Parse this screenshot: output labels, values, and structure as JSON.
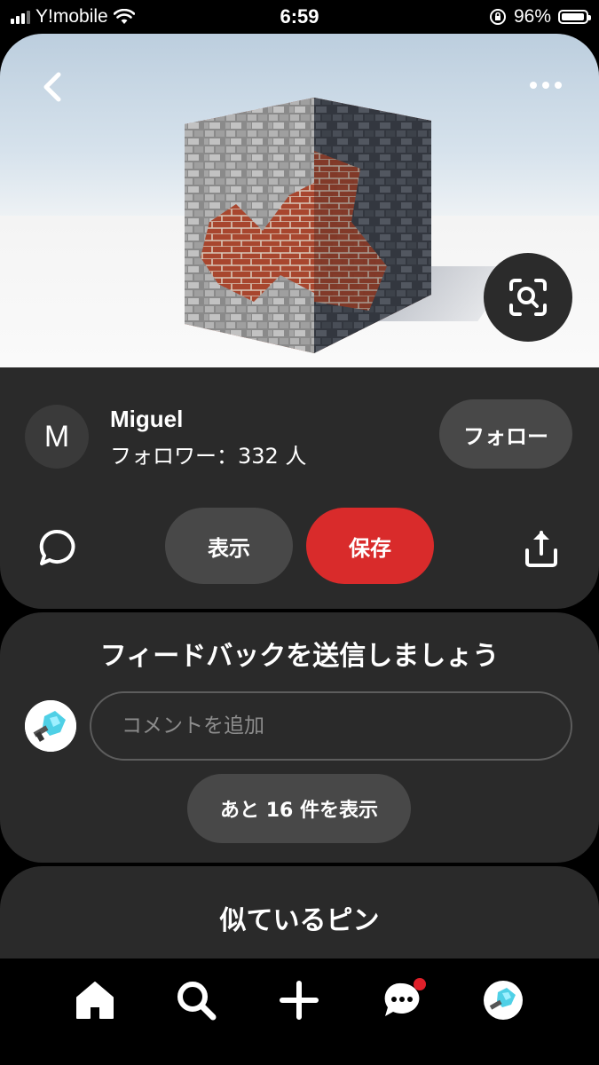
{
  "status_bar": {
    "carrier": "Y!mobile",
    "time": "6:59",
    "battery": "96%",
    "battery_level": 0.96,
    "icons": [
      "signal-icon",
      "wifi-icon",
      "orientation-lock-icon",
      "battery-icon"
    ]
  },
  "pin": {
    "image_icons": [
      "back-arrow-icon",
      "more-dots-icon",
      "visual-search-icon"
    ]
  },
  "creator": {
    "initial": "M",
    "name": "Miguel",
    "followers": "フォロワー：332 人",
    "follow_label": "フォロー"
  },
  "actions": {
    "view_label": "表示",
    "save_label": "保存",
    "save_color": "#d92b2b",
    "icons": [
      "comment-bubble-icon",
      "share-icon"
    ]
  },
  "feedback": {
    "title": "フィードバックを送信しましょう",
    "comment_placeholder": "コメントを追加",
    "more_comments": "あと 16 件を表示"
  },
  "similar": {
    "title": "似ているピン"
  },
  "tab_bar": {
    "tabs": [
      "home-icon",
      "search-icon",
      "create-plus-icon",
      "messages-icon",
      "profile-avatar"
    ],
    "notification_color": "#e0202a"
  }
}
